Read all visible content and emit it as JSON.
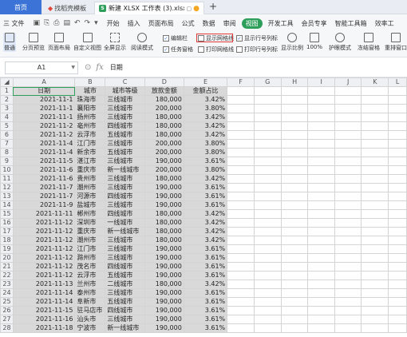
{
  "tabs": {
    "home": "首页",
    "template": "找稻壳模板",
    "document": "新建 XLSX 工作表 (3).xlsx",
    "add": "+"
  },
  "menu": {
    "file": "三 文件",
    "items": [
      "开始",
      "插入",
      "页面布局",
      "公式",
      "数据",
      "审阅",
      "视图",
      "开发工具",
      "会员专享",
      "智能工具箱",
      "效率工"
    ],
    "active_index": 6
  },
  "toolbar": {
    "normal": "普通",
    "page_break": "分页预览",
    "page_layout": "页面布局",
    "custom_view": "自定义视图",
    "fullscreen": "全屏显示",
    "reading": "阅读模式",
    "edit_bar": "编辑栏",
    "task_pane": "任务窗格",
    "show_grid": "显示网格线",
    "print_grid": "打印网格线",
    "show_headings": "显示行号列标",
    "print_headings": "打印行号列标",
    "zoom": "显示比例",
    "zoom_100": "100%",
    "eye_mode": "护眼模式",
    "freeze": "冻结窗格",
    "rearrange": "重排窗口"
  },
  "formula_bar": {
    "cell_ref": "A1",
    "value": "日期"
  },
  "columns": [
    "A",
    "B",
    "C",
    "D",
    "E",
    "F",
    "G",
    "H",
    "I",
    "J",
    "K",
    "L"
  ],
  "headers": [
    "日期",
    "城市",
    "城市等级",
    "放款金额",
    "金额占比"
  ],
  "rows": [
    [
      "2021-11-1",
      "珠海市",
      "三线城市",
      "180,000",
      "3.42%"
    ],
    [
      "2021-11-1",
      "襄阳市",
      "三线城市",
      "200,000",
      "3.80%"
    ],
    [
      "2021-11-1",
      "扬州市",
      "三线城市",
      "180,000",
      "3.42%"
    ],
    [
      "2021-11-2",
      "亳州市",
      "四线城市",
      "180,000",
      "3.42%"
    ],
    [
      "2021-11-2",
      "云浮市",
      "五线城市",
      "180,000",
      "3.42%"
    ],
    [
      "2021-11-4",
      "江门市",
      "三线城市",
      "200,000",
      "3.80%"
    ],
    [
      "2021-11-4",
      "新余市",
      "五线城市",
      "200,000",
      "3.80%"
    ],
    [
      "2021-11-5",
      "湛江市",
      "三线城市",
      "190,000",
      "3.61%"
    ],
    [
      "2021-11-6",
      "重庆市",
      "新一线城市",
      "200,000",
      "3.80%"
    ],
    [
      "2021-11-6",
      "贵州市",
      "三线城市",
      "180,000",
      "3.42%"
    ],
    [
      "2021-11-7",
      "潮州市",
      "三线城市",
      "190,000",
      "3.61%"
    ],
    [
      "2021-11-7",
      "河源市",
      "四线城市",
      "190,000",
      "3.61%"
    ],
    [
      "2021-11-9",
      "盐城市",
      "三线城市",
      "190,000",
      "3.61%"
    ],
    [
      "2021-11-11",
      "郴州市",
      "四线城市",
      "180,000",
      "3.42%"
    ],
    [
      "2021-11-12",
      "深圳市",
      "一线城市",
      "180,000",
      "3.42%"
    ],
    [
      "2021-11-12",
      "重庆市",
      "新一线城市",
      "180,000",
      "3.42%"
    ],
    [
      "2021-11-12",
      "潮州市",
      "三线城市",
      "180,000",
      "3.42%"
    ],
    [
      "2021-11-12",
      "江门市",
      "三线城市",
      "190,000",
      "3.61%"
    ],
    [
      "2021-11-12",
      "滁州市",
      "三线城市",
      "190,000",
      "3.61%"
    ],
    [
      "2021-11-12",
      "茂名市",
      "四线城市",
      "190,000",
      "3.61%"
    ],
    [
      "2021-11-12",
      "云浮市",
      "五线城市",
      "190,000",
      "3.61%"
    ],
    [
      "2021-11-13",
      "兰州市",
      "二线城市",
      "180,000",
      "3.42%"
    ],
    [
      "2021-11-14",
      "泰州市",
      "三线城市",
      "190,000",
      "3.61%"
    ],
    [
      "2021-11-14",
      "阜新市",
      "五线城市",
      "190,000",
      "3.61%"
    ],
    [
      "2021-11-15",
      "驻马店市",
      "四线城市",
      "190,000",
      "3.61%"
    ],
    [
      "2021-11-16",
      "汕头市",
      "三线城市",
      "190,000",
      "3.61%"
    ],
    [
      "2021-11-18",
      "宁波市",
      "新一线城市",
      "190,000",
      "3.61%"
    ]
  ],
  "icons": {
    "close": "×",
    "dot": "●",
    "fx": "fx",
    "zoom": "🔍",
    "check": "✓"
  }
}
